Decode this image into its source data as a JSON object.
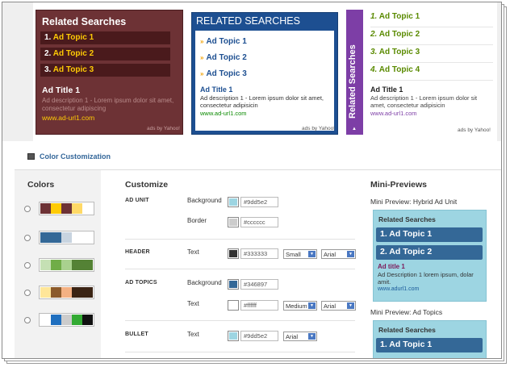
{
  "ads": {
    "maroon": {
      "heading": "Related Searches",
      "items": [
        {
          "num": "1.",
          "label": "Ad Topic 1"
        },
        {
          "num": "2.",
          "label": "Ad Topic 2"
        },
        {
          "num": "3.",
          "label": "Ad Topic 3"
        }
      ],
      "ad_title": "Ad Title 1",
      "ad_desc": "Ad description 1 - Lorem ipsum dolor sit amet, consectetur adipiscing",
      "ad_url": "www.ad-url1.com",
      "ads_by": "ads by Yahoo!",
      "color": "#6d3235",
      "accent": "#ffcb05"
    },
    "blue": {
      "heading": "RELATED SEARCHES",
      "items": [
        {
          "bullet": "»",
          "label": "Ad Topic 1"
        },
        {
          "bullet": "»",
          "label": "Ad Topic 2"
        },
        {
          "bullet": "»",
          "label": "Ad Topic 3"
        }
      ],
      "ad_title": "Ad Title 1",
      "ad_desc": "Ad description 1 - Lorem ipsum dolor sit amet, consectetur adipisicin",
      "ad_url": "www.ad-url1.com",
      "ads_by": "ads by Yahoo!",
      "color": "#1d4f91"
    },
    "purple": {
      "vertical_heading": "Related Searches",
      "items": [
        {
          "num": "1.",
          "label": "Ad Topic 1"
        },
        {
          "num": "2.",
          "label": "Ad Topic 2"
        },
        {
          "num": "3.",
          "label": "Ad Topic 3"
        },
        {
          "num": "4.",
          "label": "Ad Topic 4"
        }
      ],
      "ad_title": "Ad Title 1",
      "ad_desc": "Ad description 1 - Lorem ipsum dolor sit amet, consectetur adipisicin",
      "ad_url": "www.ad-url1.com",
      "ads_by": "ads by Yahoo!",
      "color": "#7d3ea6",
      "arrow": "▲"
    }
  },
  "color_customization": {
    "label": "Color Customization",
    "icon": "palette-icon"
  },
  "colors_panel": {
    "title": "Colors",
    "palettes": [
      {
        "swatches": [
          "#6d3235",
          "#ffcb05",
          "#6d3235",
          "#ffd966",
          "#ffffff"
        ]
      },
      {
        "swatches": [
          "#346897",
          "#346897",
          "#c8d4e0",
          "#ffffff",
          "#ffffff"
        ]
      },
      {
        "swatches": [
          "#c5e0b4",
          "#70ad47",
          "#a9d18e",
          "#548235",
          "#548235"
        ]
      },
      {
        "swatches": [
          "#ffe699",
          "#8b5a2b",
          "#f4b183",
          "#3b2414",
          "#3b2414"
        ]
      },
      {
        "swatches": [
          "#ffffff",
          "#1f6fbf",
          "#cccccc",
          "#33aa33",
          "#111111"
        ]
      }
    ]
  },
  "customize": {
    "title": "Customize",
    "sections": {
      "ad_unit": {
        "label": "AD UNIT",
        "background_label": "Background",
        "background_value": "#9dd5e2",
        "border_label": "Border",
        "border_value": "#cccccc"
      },
      "header": {
        "label": "HEADER",
        "text_label": "Text",
        "text_value": "#333333",
        "size": "Small",
        "font": "Arial"
      },
      "ad_topics": {
        "label": "AD TOPICS",
        "background_label": "Background",
        "background_value": "#346897",
        "text_label": "Text",
        "text_value": "#ffffff",
        "size": "Medium",
        "font": "Arial"
      },
      "bullet": {
        "label": "BULLET",
        "text_label": "Text",
        "text_value": "#9dd5e2",
        "font": "Arial"
      }
    }
  },
  "mini_previews": {
    "title": "Mini-Previews",
    "hybrid": {
      "caption": "Mini Preview: Hybrid Ad Unit",
      "heading": "Related Searches",
      "items": [
        {
          "num": "1.",
          "label": "Ad Topic 1"
        },
        {
          "num": "2.",
          "label": "Ad Topic 2"
        }
      ],
      "ad_title": "Ad title 1",
      "ad_desc": "Ad Description 1 lorem ipsum, dolar amit.",
      "ad_url": "www.adurl1.com"
    },
    "topics": {
      "caption": "Mini Preview: Ad Topics",
      "heading": "Related Searches",
      "items": [
        {
          "num": "1.",
          "label": "Ad Topic 1"
        }
      ]
    }
  }
}
